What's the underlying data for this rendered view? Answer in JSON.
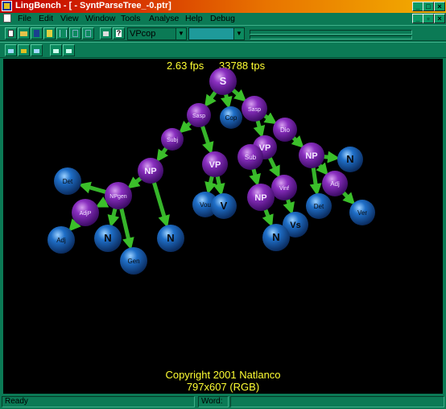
{
  "window": {
    "title": "LingBench - [ - SyntParseTree_-0.ptr]"
  },
  "menu": [
    "File",
    "Edit",
    "View",
    "Window",
    "Tools",
    "Analyse",
    "Help",
    "Debug"
  ],
  "toolbar": {
    "selector_value": "VPcop",
    "second_selector_value": ""
  },
  "viewport": {
    "fps": "2.63 fps",
    "tps": "33788 tps",
    "copyright": "Copyright 2001 Natlanco",
    "resolution": "797x607 (RGB)"
  },
  "tree": {
    "nodes": [
      {
        "id": "s",
        "label": "S",
        "color": "purple"
      },
      {
        "id": "sasp1",
        "label": "Sasp",
        "color": "purple"
      },
      {
        "id": "sasp2",
        "label": "Sasp",
        "color": "purple"
      },
      {
        "id": "cop",
        "label": "Cop",
        "color": "blue"
      },
      {
        "id": "subj",
        "label": "Subj",
        "color": "purple"
      },
      {
        "id": "vp1",
        "label": "VP",
        "color": "purple"
      },
      {
        "id": "dio",
        "label": "Dio",
        "color": "purple"
      },
      {
        "id": "vp2",
        "label": "VP",
        "color": "purple"
      },
      {
        "id": "sub",
        "label": "Sub",
        "color": "purple"
      },
      {
        "id": "np1",
        "label": "NP",
        "color": "purple"
      },
      {
        "id": "np2",
        "label": "NP",
        "color": "purple"
      },
      {
        "id": "n1",
        "label": "N",
        "color": "blue"
      },
      {
        "id": "det1",
        "label": "Det",
        "color": "blue"
      },
      {
        "id": "npgen",
        "label": "NPgen",
        "color": "purple"
      },
      {
        "id": "vou",
        "label": "Vou",
        "color": "blue"
      },
      {
        "id": "v1",
        "label": "V",
        "color": "blue"
      },
      {
        "id": "vinf",
        "label": "Vinf",
        "color": "purple"
      },
      {
        "id": "adj1",
        "label": "Adj",
        "color": "purple"
      },
      {
        "id": "np3",
        "label": "NP",
        "color": "purple"
      },
      {
        "id": "det2",
        "label": "Det",
        "color": "blue"
      },
      {
        "id": "ver",
        "label": "Ver",
        "color": "blue"
      },
      {
        "id": "adjp",
        "label": "AdjP",
        "color": "purple"
      },
      {
        "id": "vs",
        "label": "Vs",
        "color": "blue"
      },
      {
        "id": "adj2",
        "label": "Adj",
        "color": "blue"
      },
      {
        "id": "n2",
        "label": "N",
        "color": "blue"
      },
      {
        "id": "n3",
        "label": "N",
        "color": "blue"
      },
      {
        "id": "n4",
        "label": "N",
        "color": "blue"
      },
      {
        "id": "gen",
        "label": "Gen",
        "color": "blue"
      }
    ]
  },
  "statusbar": {
    "ready": "Ready",
    "word": "Word:"
  }
}
